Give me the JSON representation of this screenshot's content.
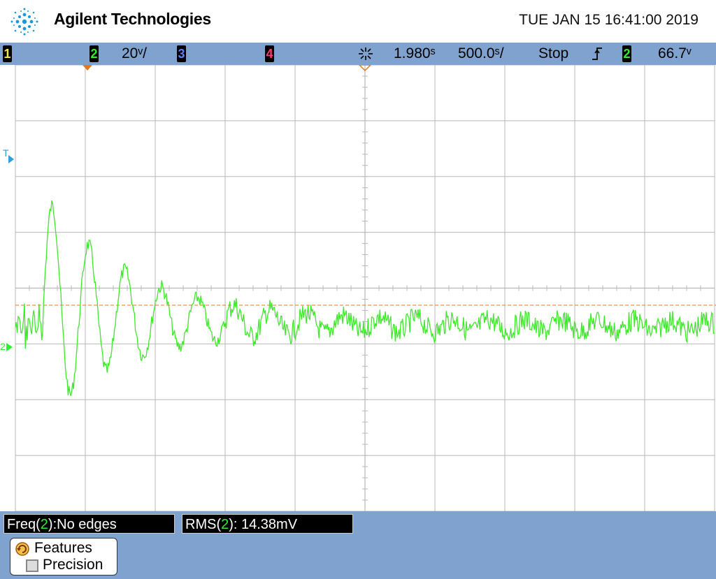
{
  "header": {
    "brand": "Agilent Technologies",
    "datetime": "TUE JAN 15 16:41:00 2019"
  },
  "statusbar": {
    "ch1_label": "1",
    "ch2_label": "2",
    "ch2_scale": "20ᵛ/",
    "ch3_label": "3",
    "ch4_label": "4",
    "time_delay": "1.980ˢ",
    "time_scale": "500.0ˢ/",
    "run_state": "Stop",
    "trigger_source": "2",
    "trigger_level": "66.7ᵛ",
    "colors": {
      "ch1": "#f5e84a",
      "ch2": "#2ef02e",
      "ch3": "#5a7fff",
      "ch4": "#ff3d6e"
    }
  },
  "graticule": {
    "trigger_marker": "T",
    "ground_marker": "2",
    "trace_color": "#3ee82a",
    "trigger_line_color": "#e07a1c",
    "grid_color": "#b8b8b8"
  },
  "measurements": {
    "freq_label": "Freq(",
    "freq_channel": "2",
    "freq_value": "):No edges",
    "rms_label": "RMS(",
    "rms_channel": "2",
    "rms_value": "): 14.38mV"
  },
  "softkey": {
    "line1": "Features",
    "line2": "Precision",
    "icon": "rotate-arrow-icon",
    "check_icon": "checkbox-icon"
  }
}
